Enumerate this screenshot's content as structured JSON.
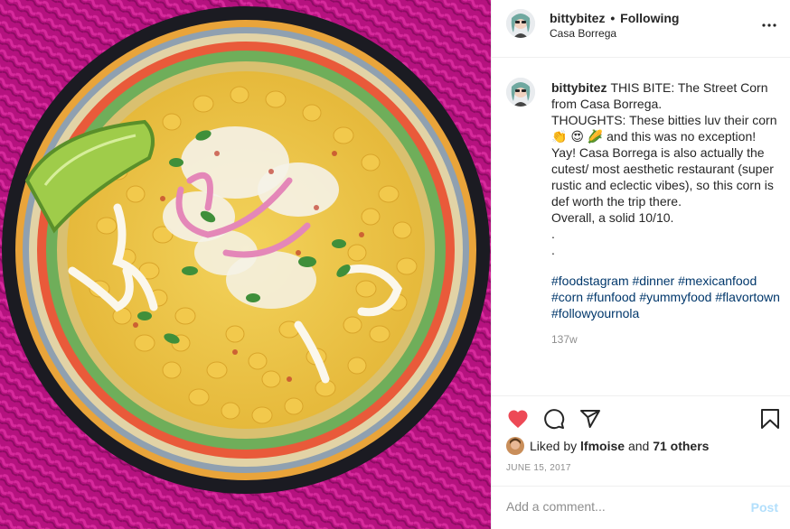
{
  "post": {
    "image_alt": "Street corn in a colorful bowl with lime wedge",
    "header": {
      "username": "bittybitez",
      "separator": "•",
      "follow_label": "Following",
      "location": "Casa Borrega",
      "more_icon": "more-horizontal-icon"
    },
    "caption": {
      "username": "bittybitez",
      "text": "THIS BITE: The Street Corn from Casa Borrega.\nTHOUGHTS: These bitties luv their corn 👏 😍 🌽  and this was no exception! Yay! Casa Borrega is also actually the cutest/ most aesthetic restaurant (super rustic and eclectic vibes), so this corn is def worth the trip there.\nOverall, a solid 10/10.\n.\n.",
      "hashtags": [
        "#foodstagram",
        "#dinner",
        "#mexicanfood",
        "#corn",
        "#funfood",
        "#yummyfood",
        "#flavortown",
        "#followyournola"
      ],
      "age": "137w"
    },
    "actions": {
      "like_icon": "heart-filled-icon",
      "comment_icon": "comment-icon",
      "share_icon": "paper-plane-icon",
      "save_icon": "bookmark-icon",
      "like_color": "#ed4956"
    },
    "likes": {
      "prefix": "Liked by",
      "liker": "lfmoise",
      "conjunction": "and",
      "others": "71 others"
    },
    "date": "JUNE 15, 2017",
    "comment": {
      "placeholder": "Add a comment...",
      "post_label": "Post"
    }
  }
}
